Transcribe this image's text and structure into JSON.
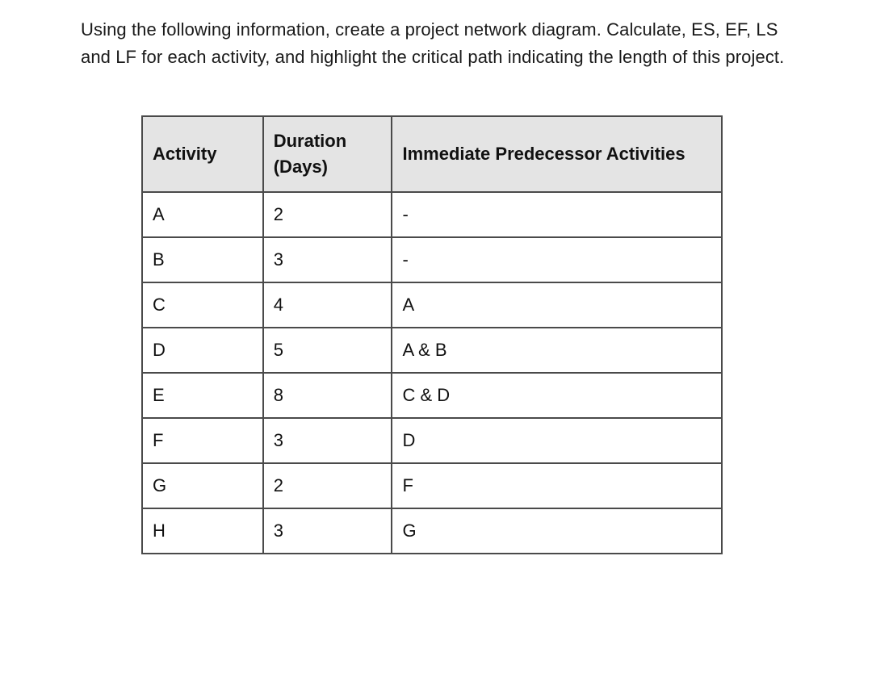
{
  "intro": "Using the following information, create a project network diagram. Calculate, ES, EF, LS and LF for each activity, and highlight the critical path indicating the length of this project.",
  "table": {
    "headers": {
      "activity": "Activity",
      "duration": "Duration (Days)",
      "predecessor": "Immediate Predecessor Activities"
    },
    "rows": [
      {
        "activity": "A",
        "duration": "2",
        "predecessor": "-"
      },
      {
        "activity": "B",
        "duration": "3",
        "predecessor": "-"
      },
      {
        "activity": "C",
        "duration": "4",
        "predecessor": "A"
      },
      {
        "activity": "D",
        "duration": "5",
        "predecessor": "A & B"
      },
      {
        "activity": "E",
        "duration": "8",
        "predecessor": "C & D"
      },
      {
        "activity": "F",
        "duration": "3",
        "predecessor": "D"
      },
      {
        "activity": "G",
        "duration": "2",
        "predecessor": "F"
      },
      {
        "activity": "H",
        "duration": "3",
        "predecessor": "G"
      }
    ]
  }
}
